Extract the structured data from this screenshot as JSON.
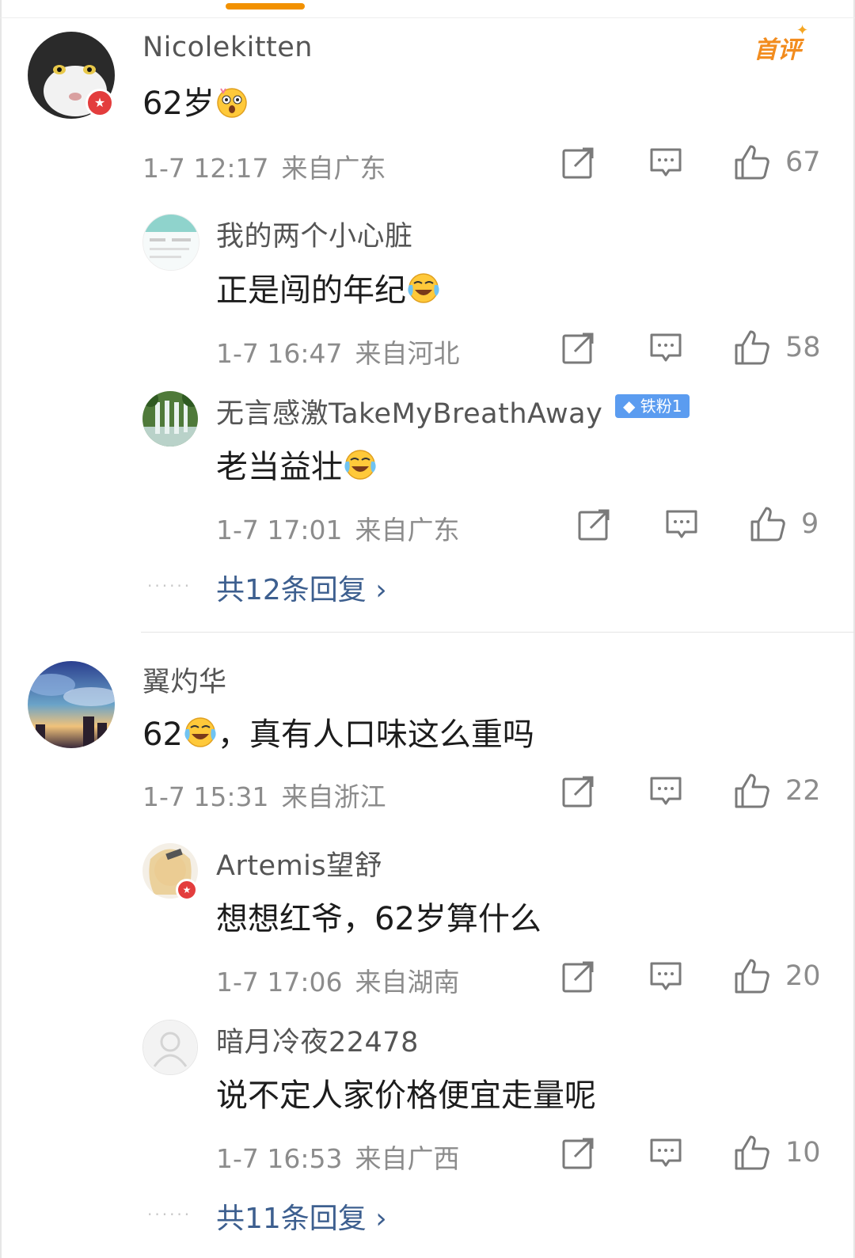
{
  "comments": [
    {
      "username": "Nicolekitten",
      "text": "62岁",
      "time": "1-7 12:17",
      "location": "来自广东",
      "likes": "67",
      "first_review_label": "首评",
      "replies": [
        {
          "username": "我的两个小心脏",
          "text": "正是闯的年纪",
          "time": "1-7 16:47",
          "location": "来自河北",
          "likes": "58"
        },
        {
          "username": "无言感激TakeMyBreathAway",
          "badge": "铁粉1",
          "text": "老当益壮",
          "time": "1-7 17:01",
          "location": "来自广东",
          "likes": "9"
        }
      ],
      "more_replies": "共12条回复 ›"
    },
    {
      "username": "翼灼华",
      "text_part1": "62",
      "text_part2": "，真有人口味这么重吗",
      "time": "1-7 15:31",
      "location": "来自浙江",
      "likes": "22",
      "replies": [
        {
          "username": "Artemis望舒",
          "text": "想想红爷，62岁算什么",
          "time": "1-7 17:06",
          "location": "来自湖南",
          "likes": "20"
        },
        {
          "username": "暗月冷夜22478",
          "text": "说不定人家价格便宜走量呢",
          "time": "1-7 16:53",
          "location": "来自广西",
          "likes": "10"
        }
      ],
      "more_replies": "共11条回复 ›"
    }
  ],
  "icons": {
    "share": "share-icon",
    "comment": "comment-icon",
    "like": "thumbs-up-icon",
    "emoji_shock": "shocked-face-emoji",
    "emoji_laugh_cry": "laughing-crying-emoji"
  },
  "colors": {
    "accent": "#f29100",
    "link": "#3d5f8f",
    "meta_text": "#8c8c8c",
    "fan_badge": "#5b9cf0",
    "verified_badge": "#e33d3d"
  }
}
